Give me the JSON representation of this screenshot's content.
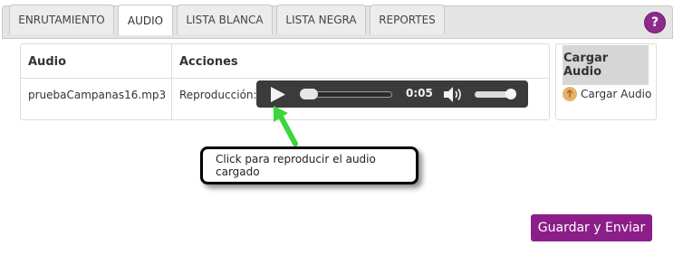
{
  "tabs": [
    {
      "label": "ENRUTAMIENTO",
      "active": false
    },
    {
      "label": "AUDIO",
      "active": true
    },
    {
      "label": "LISTA BLANCA",
      "active": false
    },
    {
      "label": "LISTA NEGRA",
      "active": false
    },
    {
      "label": "REPORTES",
      "active": false
    }
  ],
  "help": {
    "label": "?",
    "icon": "help-icon"
  },
  "table": {
    "headers": {
      "audio": "Audio",
      "actions": "Acciones"
    },
    "row": {
      "file": "pruebaCampanas16.mp3",
      "playback_label": "Reproducción:"
    }
  },
  "player": {
    "time": "0:05",
    "icons": {
      "play": "play-icon",
      "volume": "volume-icon"
    },
    "progress_fraction": 0.05,
    "volume_fraction": 0.85
  },
  "upload": {
    "header": "Cargar Audio",
    "button": "Cargar Audio",
    "icon": "upload-icon"
  },
  "callout": {
    "text": "Click para reproducir el audio cargado"
  },
  "save": {
    "label": "Guardar y Enviar"
  },
  "colors": {
    "accent": "#8c1e8a",
    "arrow": "#3ad63a",
    "player_bg": "#3b3b3b"
  }
}
